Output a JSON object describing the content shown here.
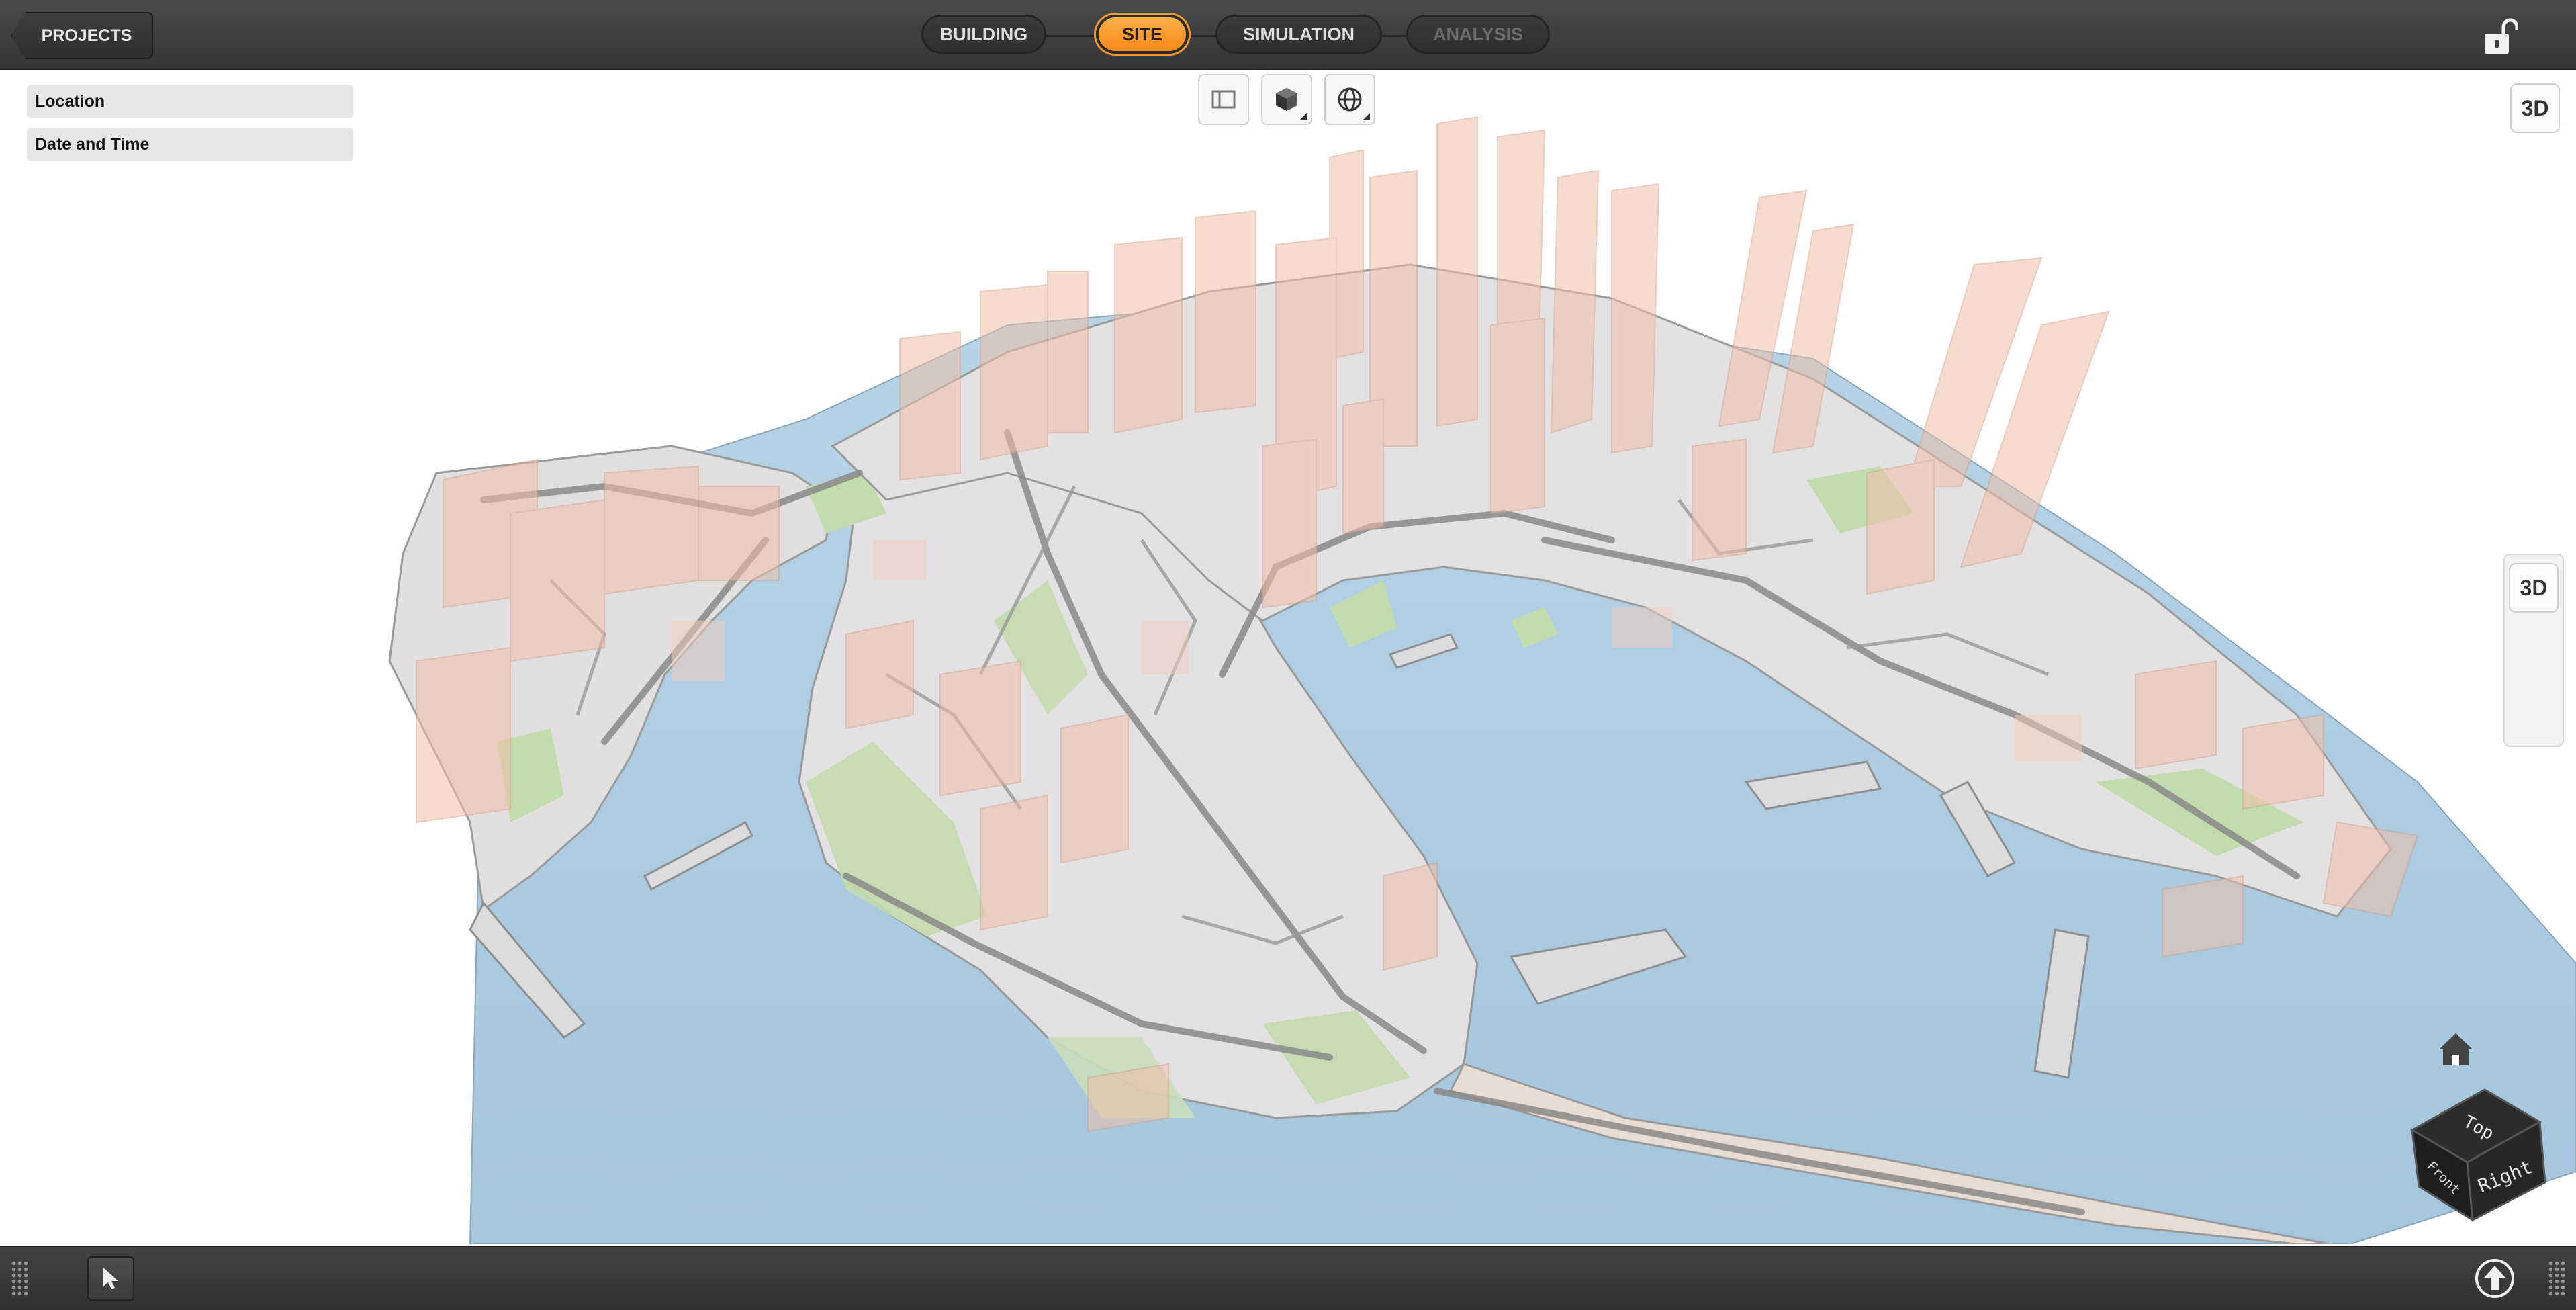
{
  "topbar": {
    "projects_label": "PROJECTS",
    "workflow_tabs": [
      {
        "label": "BUILDING",
        "state": "normal"
      },
      {
        "label": "SITE",
        "state": "active"
      },
      {
        "label": "SIMULATION",
        "state": "normal"
      },
      {
        "label": "ANALYSIS",
        "state": "disabled"
      }
    ],
    "lock_icon": "unlocked-padlock-icon"
  },
  "left_panel": {
    "sections": [
      {
        "label": "Location"
      },
      {
        "label": "Date and Time"
      }
    ]
  },
  "view_toolbar": {
    "buttons": [
      {
        "icon": "panel-toggle-icon"
      },
      {
        "icon": "cube-view-icon"
      },
      {
        "icon": "globe-icon"
      }
    ]
  },
  "viewport": {
    "mode_badge": "3D",
    "side_dock_badge": "3D"
  },
  "viewcube": {
    "faces": {
      "top": "Top",
      "front": "Front",
      "right": "Right"
    },
    "home_icon": "home-icon"
  },
  "bottombar": {
    "tool_icon": "select-arrow-icon",
    "upload_icon": "upload-circle-icon"
  },
  "colors": {
    "active_tab": "#f7941d",
    "water": "#a9cbe0",
    "land": "#e4e2e3",
    "park": "#bfdba8",
    "buildings": "#f0c2ae",
    "roads": "#8c8c8c",
    "bar_bg": "#3a3a3a"
  }
}
